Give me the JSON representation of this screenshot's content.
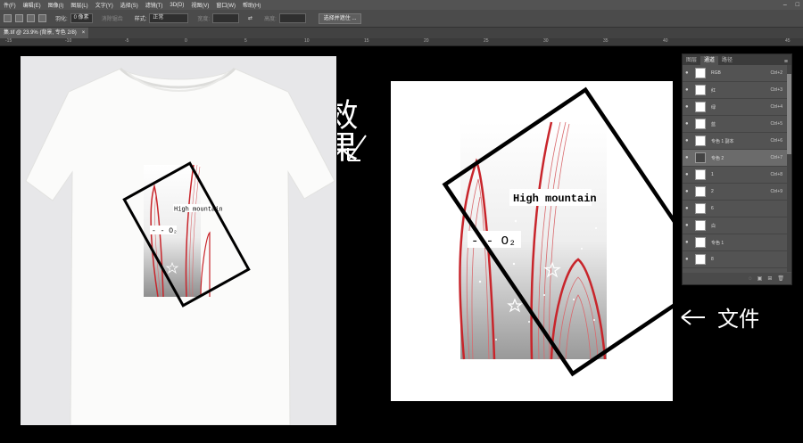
{
  "menu": {
    "items": [
      "件(F)",
      "编辑(E)",
      "图像(I)",
      "图层(L)",
      "文字(Y)",
      "选择(S)",
      "滤镜(T)",
      "3D(D)",
      "视图(V)",
      "窗口(W)",
      "帮助(H)"
    ]
  },
  "options": {
    "feather_label": "羽化:",
    "feather_value": "0 像素",
    "antialias_label": "消除锯齿",
    "style_label": "样式:",
    "style_value": "正常",
    "width_label": "宽度:",
    "height_label": "高度:",
    "select_mask_button": "选择并遮住 ..."
  },
  "document": {
    "tab_title": "集.tif @ 23.9% (背景, 专色 2/8)",
    "tab_close": "×"
  },
  "ruler": {
    "ticks": [
      "-15",
      "-10",
      "-5",
      "0",
      "5",
      "10",
      "15",
      "20",
      "25",
      "30",
      "35",
      "40",
      "45"
    ]
  },
  "artwork": {
    "title_text": "High mountain",
    "subtitle_text": "- - O₂"
  },
  "annotations": {
    "effect_label": "效果",
    "file_label": "文件"
  },
  "channels_panel": {
    "tabs": [
      "图层",
      "通道",
      "路径"
    ],
    "active_tab": "通道",
    "channels": [
      {
        "name": "RGB",
        "shortcut": "Ctrl+2"
      },
      {
        "name": "红",
        "shortcut": "Ctrl+3"
      },
      {
        "name": "绿",
        "shortcut": "Ctrl+4"
      },
      {
        "name": "蓝",
        "shortcut": "Ctrl+5"
      },
      {
        "name": "专色 1 副本",
        "shortcut": "Ctrl+6"
      },
      {
        "name": "专色 2",
        "shortcut": "Ctrl+7"
      },
      {
        "name": "1",
        "shortcut": "Ctrl+8"
      },
      {
        "name": "2",
        "shortcut": "Ctrl+9"
      },
      {
        "name": "6",
        "shortcut": ""
      },
      {
        "name": "白",
        "shortcut": ""
      },
      {
        "name": "专色 1",
        "shortcut": ""
      },
      {
        "name": "8",
        "shortcut": ""
      }
    ],
    "selected_channel": "专色 2"
  },
  "colors": {
    "accent_red": "#c8252b",
    "frame": "#000000"
  }
}
